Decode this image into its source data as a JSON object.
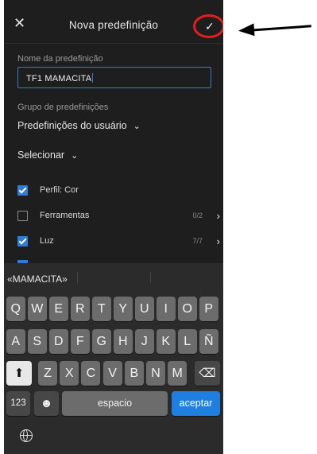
{
  "header": {
    "title": "Nova predefinição",
    "close_glyph": "✕",
    "confirm_glyph": "✓"
  },
  "form": {
    "name_label": "Nome da predefinição",
    "name_value": "TF1 MAMACITA",
    "group_label": "Grupo de predefinições",
    "group_value": "Predefinições do usuário",
    "select_label": "Selecionar"
  },
  "settings": [
    {
      "label": "Perfil: Cor",
      "checked": true,
      "count": "",
      "chevron": ""
    },
    {
      "label": "Ferramentas",
      "checked": false,
      "count": "0/2",
      "chevron": "›"
    },
    {
      "label": "Luz",
      "checked": true,
      "count": "7/7",
      "chevron": "›"
    }
  ],
  "keyboard": {
    "suggestion": "«MAMACITA»",
    "row1": [
      "Q",
      "W",
      "E",
      "R",
      "T",
      "Y",
      "U",
      "I",
      "O",
      "P"
    ],
    "row2": [
      "A",
      "S",
      "D",
      "F",
      "G",
      "H",
      "J",
      "K",
      "L",
      "Ñ"
    ],
    "row3": [
      "Z",
      "X",
      "C",
      "V",
      "B",
      "N",
      "M"
    ],
    "numbers_key": "123",
    "emoji_key": "☻",
    "space_label": "espacio",
    "return_label": "aceptar",
    "shift_glyph": "⬆",
    "delete_glyph": "⌫"
  },
  "colors": {
    "accent": "#2f7bd8",
    "annotation_circle": "#e41d1d",
    "background": "#1e1e1e"
  },
  "icons": {
    "close": "close-icon",
    "confirm": "check-icon",
    "chevron": "chevron-down-icon",
    "globe": "globe-icon",
    "annotation": "arrow-left-icon"
  }
}
